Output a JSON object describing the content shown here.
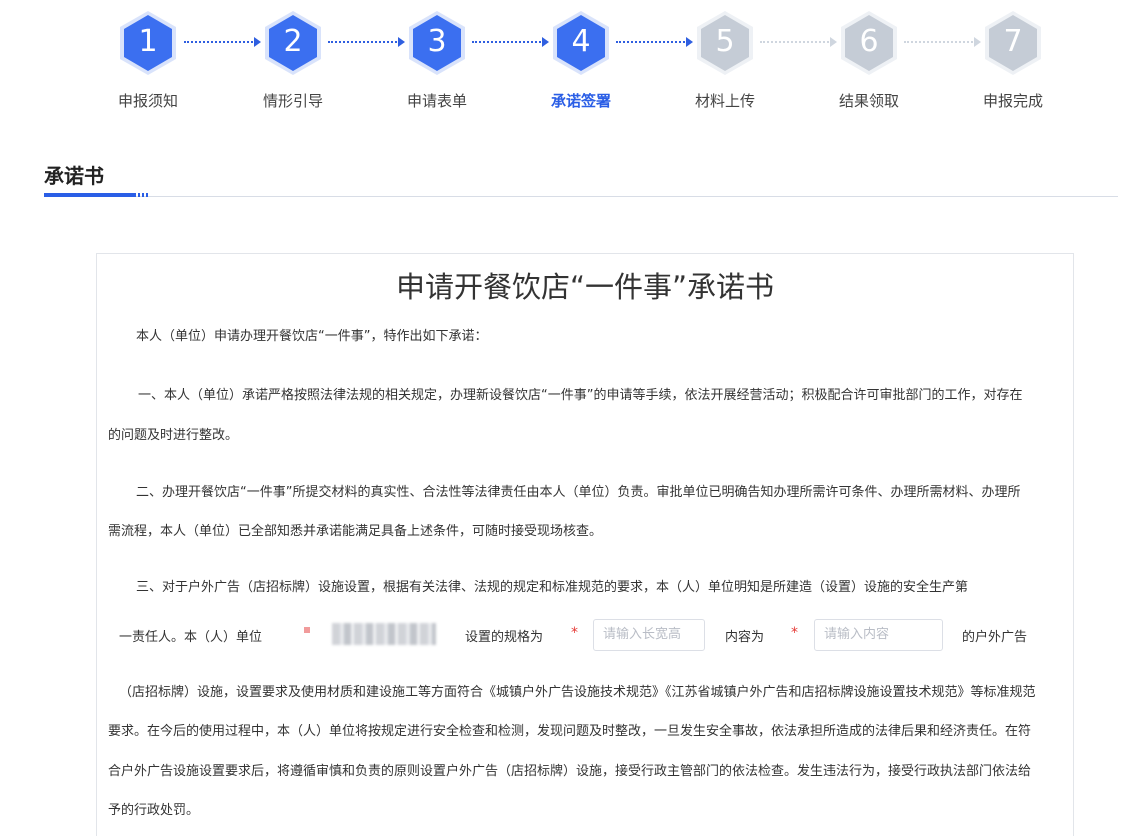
{
  "steps": [
    {
      "num": "1",
      "label": "申报须知",
      "state": "done"
    },
    {
      "num": "2",
      "label": "情形引导",
      "state": "done"
    },
    {
      "num": "3",
      "label": "申请表单",
      "state": "done"
    },
    {
      "num": "4",
      "label": "承诺签署",
      "state": "current"
    },
    {
      "num": "5",
      "label": "材料上传",
      "state": "todo"
    },
    {
      "num": "6",
      "label": "结果领取",
      "state": "todo"
    },
    {
      "num": "7",
      "label": "申报完成",
      "state": "todo"
    }
  ],
  "colors": {
    "accent": "#2a5ee6",
    "step_done": "#3b6ff0",
    "step_todo": "#c5ccd6",
    "required": "#e53935"
  },
  "section": {
    "title": "承诺书"
  },
  "document": {
    "title": "申请开餐饮店“一件事”承诺书",
    "intro": "本人（单位）申请办理开餐饮店“一件事”，特作出如下承诺：",
    "p1_line1": "一、本人（单位）承诺严格按照法律法规的相关规定，办理新设餐饮店“一件事”的申请等手续，依法开展经营活动；积极配合许可审批部门的工作，对存在",
    "p1_line2": "的问题及时进行整改。",
    "p2_line1": "二、办理开餐饮店“一件事”所提交材料的真实性、合法性等法律责任由本人（单位）负责。审批单位已明确告知办理所需许可条件、办理所需材料、办理所",
    "p2_line2": "需流程，本人（单位）已全部知悉并承诺能满足具备上述条件，可随时接受现场核查。",
    "p3_line1": "三、对于户外广告（店招标牌）设施设置，根据有关法律、法规的规定和标准规范的要求，本（人）单位明知是所建造（设置）设施的安全生产第",
    "p3_line2_a": "一责任人。本（人）单位",
    "p3_line2_b": "设置的规格为",
    "p3_line2_c": "内容为",
    "p3_line2_d": "的户外广告",
    "required_mark": "*",
    "size_placeholder": "请输入长宽高",
    "content_placeholder": "请输入内容",
    "p3_line3": "（店招标牌）设施，设置要求及使用材质和建设施工等方面符合《城镇户外广告设施技术规范》《江苏省城镇户外广告和店招标牌设施设置技术规范》等标准规范",
    "p3_line4": "要求。在今后的使用过程中，本（人）单位将按规定进行安全检查和检测，发现问题及时整改，一旦发生安全事故，依法承担所造成的法律后果和经济责任。在符",
    "p3_line5": "合户外广告设施设置要求后，将遵循审慎和负责的原则设置户外广告（店招标牌）设施，接受行政主管部门的依法检查。发生违法行为，接受行政执法部门依法给",
    "p3_line6": "予的行政处罚。"
  }
}
